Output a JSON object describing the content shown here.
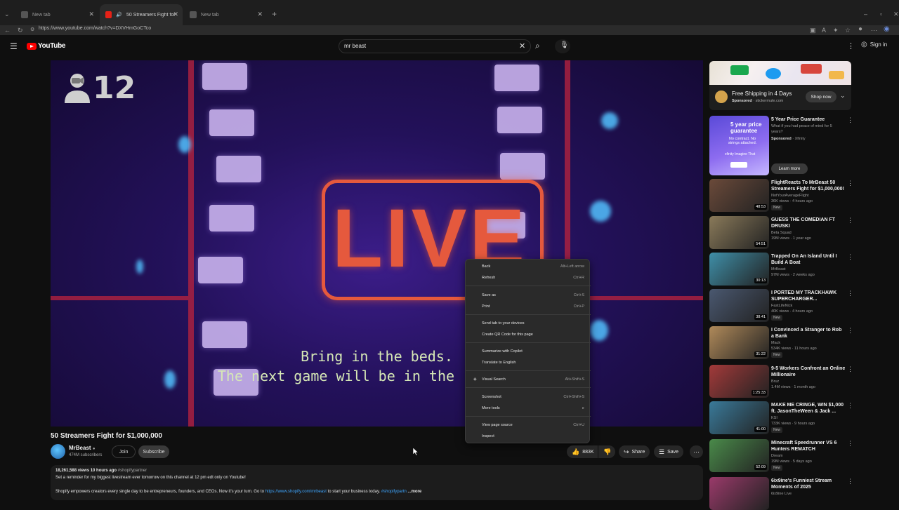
{
  "browser": {
    "tabs": [
      {
        "label": "New tab",
        "active": false
      },
      {
        "label": "50 Streamers Fight for $1,000,0",
        "active": true
      },
      {
        "label": "New tab",
        "active": false
      }
    ],
    "url": "https://www.youtube.com/watch?v=DXVHmGoCTco"
  },
  "youtube": {
    "logo_text": "YouTube",
    "search_value": "mr beast",
    "sign_in": "Sign in"
  },
  "video": {
    "viewer_count": "12",
    "live_text": "LIVE",
    "caption_line1": "Bring in the beds.",
    "caption_line2": "The next game will be in the r",
    "title": "50 Streamers Fight for $1,000,000",
    "channel": "MrBeast",
    "subscribers": "474M subscribers",
    "join_label": "Join",
    "subscribe_label": "Subscribe",
    "likes": "883K",
    "share_label": "Share",
    "save_label": "Save",
    "description": {
      "stats": "18,261,588 views  10 hours ago",
      "tag": "#shopifypartner",
      "line2": "Set a reminder for my biggest livestream ever tomorrow on this channel at 12 pm edt only on Youtube!",
      "line3_a": "Shopify empowers creators every single day to be entrepreneurs, founders, and CEOs. Now it's your turn. Go to",
      "line3_link": "https://www.shopify.com/mrbeast",
      "line3_b": "to start your business today.",
      "line3_tag": "#shopifypartn",
      "more": "...more"
    }
  },
  "context_menu": [
    {
      "label": "Back",
      "shortcut": "Alt+Left arrow"
    },
    {
      "label": "Refresh",
      "shortcut": "Ctrl+R"
    },
    {
      "label": "Save as",
      "shortcut": "Ctrl+S"
    },
    {
      "label": "Print",
      "shortcut": "Ctrl+P"
    },
    {
      "label": "Send tab to your devices",
      "shortcut": ""
    },
    {
      "label": "Create QR Code for this page",
      "shortcut": ""
    },
    {
      "label": "Summarize with Copilot",
      "shortcut": ""
    },
    {
      "label": "Translate to English",
      "shortcut": ""
    },
    {
      "label": "Visual Search",
      "shortcut": "Alt+Shift+S"
    },
    {
      "label": "Screenshot",
      "shortcut": "Ctrl+Shift+S"
    },
    {
      "label": "More tools",
      "shortcut": "▸"
    },
    {
      "label": "View page source",
      "shortcut": "Ctrl+U"
    },
    {
      "label": "Inspect",
      "shortcut": ""
    }
  ],
  "sidebar": {
    "ad_top": {
      "title": "Free Shipping in 4 Days",
      "sponsored": "Sponsored",
      "domain": "· stickermule.com",
      "cta": "Shop now"
    },
    "ad_card": {
      "title": "5 Year Price Guarantee",
      "desc": "What if you had peace of mind for 5 years?",
      "sponsored": "Sponsored",
      "advertiser": "· Xfinity",
      "cta": "Learn more",
      "thumb_heading": "5 year price guarantee",
      "thumb_sub": "No contract. No strings attached.",
      "thumb_brand": "xfinity Imagine That"
    },
    "videos": [
      {
        "title": "FlightReacts To MrBeast 50 Streamers Fight for $1,000,000!",
        "channel": "NotYourAverageFlight",
        "meta": "36K views · 4 hours ago",
        "new": "New",
        "duration": "48:53",
        "color": "#6b4a3a"
      },
      {
        "title": "GUESS THE COMEDIAN FT DRUSKI",
        "channel": "Beta Squad",
        "meta": "19M views · 1 year ago",
        "new": "",
        "duration": "54:51",
        "color": "#8a7a5a"
      },
      {
        "title": "Trapped On An Island Until I Build A Boat",
        "channel": "MrBeast",
        "meta": "97M views · 2 weeks ago",
        "new": "",
        "duration": "30:13",
        "color": "#3f8fa8"
      },
      {
        "title": "I PORTED MY TRACKHAWK SUPERCHARGER...",
        "channel": "FastLifeNick",
        "meta": "40K views · 4 hours ago",
        "new": "New",
        "duration": "38:41",
        "color": "#4a5870"
      },
      {
        "title": "I Convinced a Stranger to Rob a Bank",
        "channel": "Mack",
        "meta": "534K views · 11 hours ago",
        "new": "New",
        "duration": "31:22",
        "color": "#b08a5a"
      },
      {
        "title": "9-5 Workers Confront an Online Millionaire",
        "channel": "Bruz",
        "meta": "1.4M views · 1 month ago",
        "new": "",
        "duration": "1:25:33",
        "color": "#a33a3a"
      },
      {
        "title": "MAKE ME CRINGE, WIN $1,000 ft. JasonTheWeen & Jack ...",
        "channel": "KSI",
        "meta": "733K views · 9 hours ago",
        "new": "New",
        "duration": "41:00",
        "color": "#3a7a9a"
      },
      {
        "title": "Minecraft Speedrunner VS 6 Hunters REMATCH",
        "channel": "Dream",
        "meta": "19M views · 5 days ago",
        "new": "New",
        "duration": "52:09",
        "color": "#4a8a4a"
      },
      {
        "title": "6ix9ine's Funniest Stream Moments of 2025",
        "channel": "6ix9ine Live",
        "meta": "",
        "new": "",
        "duration": "",
        "color": "#9a3a6a"
      }
    ]
  }
}
